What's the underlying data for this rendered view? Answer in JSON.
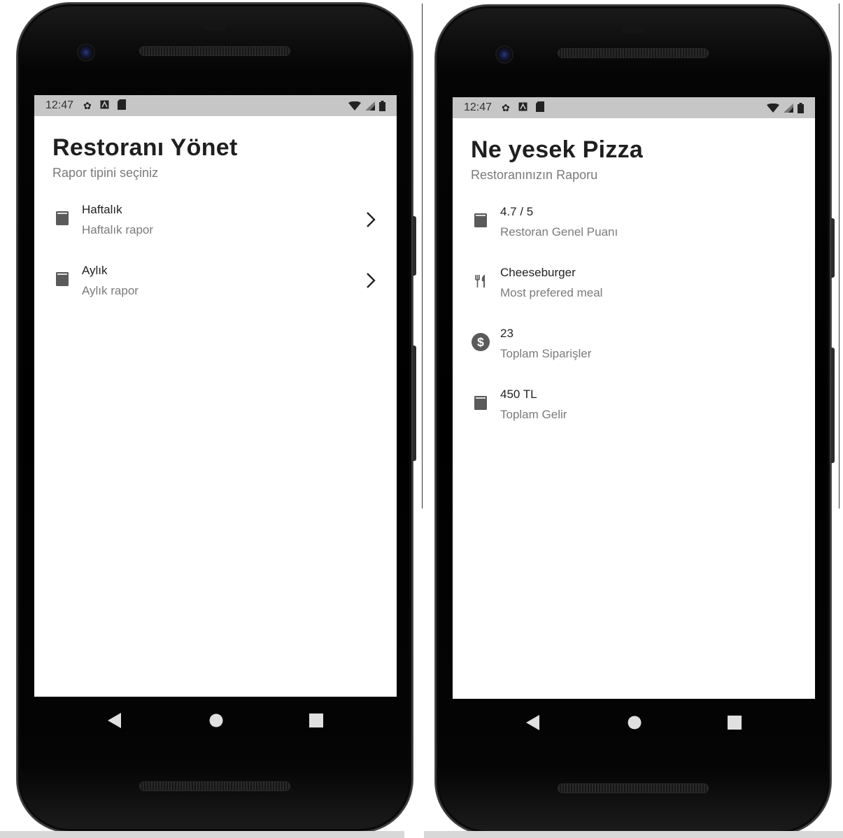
{
  "left_screen": {
    "status": {
      "time": "12:47"
    },
    "title": "Restoranı Yönet",
    "subtitle": "Rapor tipini seçiniz",
    "items": [
      {
        "icon": "calculator-icon",
        "primary": "Haftalık",
        "secondary": "Haftalık rapor"
      },
      {
        "icon": "calculator-icon",
        "primary": "Aylık",
        "secondary": "Aylık rapor"
      }
    ]
  },
  "right_screen": {
    "status": {
      "time": "12:47"
    },
    "title": "Ne yesek Pizza",
    "subtitle": "Restoranınızın Raporu",
    "items": [
      {
        "icon": "calculator-icon",
        "primary": "4.7 / 5",
        "secondary": "Restoran Genel Puanı"
      },
      {
        "icon": "restaurant-icon",
        "primary": "Cheeseburger",
        "secondary": "Most prefered meal"
      },
      {
        "icon": "dollar-circle-icon",
        "primary": "23",
        "secondary": "Toplam Siparişler"
      },
      {
        "icon": "calculator-icon",
        "primary": "450 TL",
        "secondary": "Toplam Gelir"
      }
    ]
  },
  "colors": {
    "status_bar": "#c6c6c6",
    "icon": "#5a5a5a",
    "title": "#1f1f1f",
    "secondary_text": "#7b7b7b"
  }
}
